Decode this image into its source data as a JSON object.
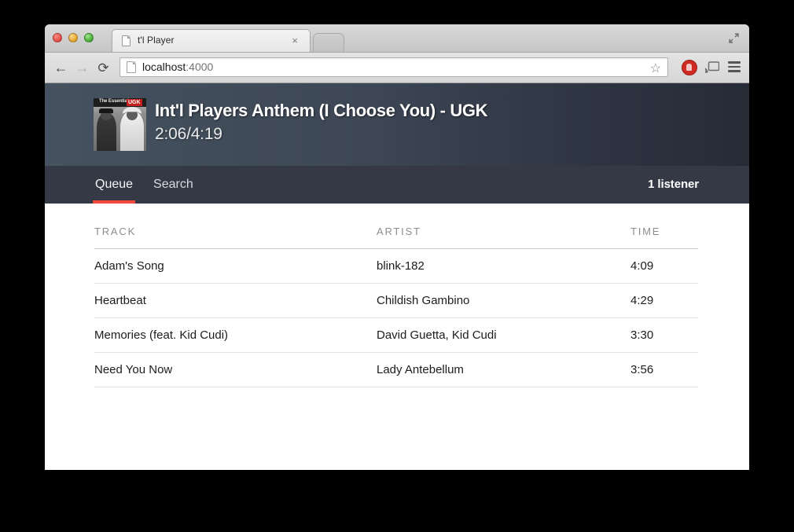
{
  "browser": {
    "tab": {
      "title": "t'l Player",
      "favicon": "document-icon",
      "close_label": "×"
    },
    "new_tab_label": "",
    "fullscreen_icon": "fullscreen-icon",
    "nav": {
      "back": "←",
      "forward": "→",
      "reload": "⟳"
    },
    "omnibox": {
      "url_host": "localhost",
      "url_port": ":4000",
      "favicon": "page-icon",
      "star": "☆"
    },
    "extensions": {
      "adblock": "adblock-icon",
      "cast": "cast-icon",
      "menu": "hamburger-menu-icon"
    }
  },
  "player": {
    "album_art": {
      "label_essential": "The Essential",
      "label_artist": "UGK"
    },
    "now_playing_title": "Int'l Players Anthem (I Choose You) - UGK",
    "time_display": "2:06/4:19"
  },
  "nav": {
    "tabs": [
      {
        "label": "Queue",
        "active": true
      },
      {
        "label": "Search",
        "active": false
      }
    ],
    "listener_count": "1 listener",
    "accent_color": "#fa4a3c"
  },
  "queue": {
    "columns": [
      "TRACK",
      "ARTIST",
      "TIME"
    ],
    "rows": [
      {
        "track": "Adam's Song",
        "artist": "blink-182",
        "time": "4:09"
      },
      {
        "track": "Heartbeat",
        "artist": "Childish Gambino",
        "time": "4:29"
      },
      {
        "track": "Memories (feat. Kid Cudi)",
        "artist": "David Guetta, Kid Cudi",
        "time": "3:30"
      },
      {
        "track": "Need You Now",
        "artist": "Lady Antebellum",
        "time": "3:56"
      }
    ]
  }
}
